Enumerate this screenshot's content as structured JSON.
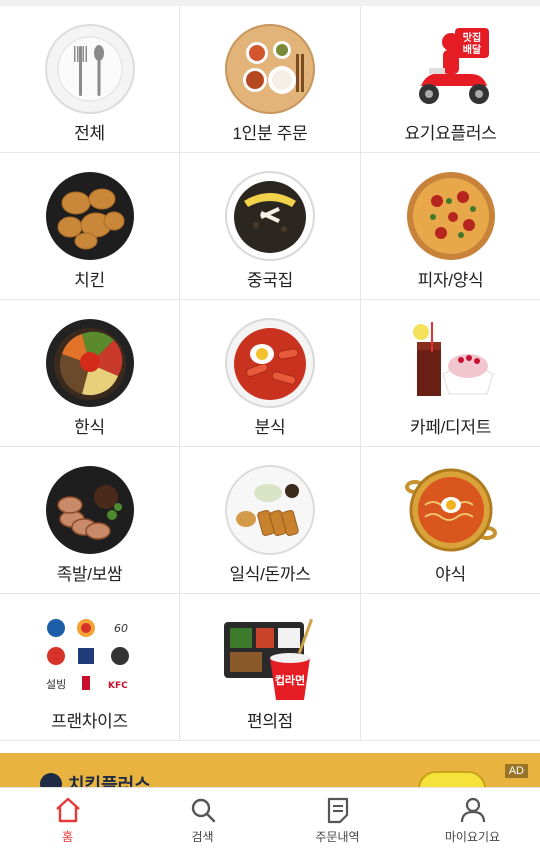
{
  "categories": [
    {
      "label": "전체",
      "icon": "cutlery-plate-icon"
    },
    {
      "label": "1인분 주문",
      "icon": "single-meal-tray-icon"
    },
    {
      "label": "요기요플러스",
      "icon": "delivery-scooter-icon",
      "badge": "맛집\n배달"
    },
    {
      "label": "치킨",
      "icon": "fried-chicken-icon"
    },
    {
      "label": "중국집",
      "icon": "jajangmyeon-icon"
    },
    {
      "label": "피자/양식",
      "icon": "pizza-icon"
    },
    {
      "label": "한식",
      "icon": "bibimbap-icon"
    },
    {
      "label": "분식",
      "icon": "tteokbokki-icon"
    },
    {
      "label": "카페/디저트",
      "icon": "cafe-dessert-icon"
    },
    {
      "label": "족발/보쌈",
      "icon": "jokbal-icon"
    },
    {
      "label": "일식/돈까스",
      "icon": "tonkatsu-icon"
    },
    {
      "label": "야식",
      "icon": "ramen-pot-icon"
    },
    {
      "label": "프랜차이즈",
      "icon": "franchise-logos-icon"
    },
    {
      "label": "편의점",
      "icon": "convenience-store-icon",
      "badge": "컵라면"
    }
  ],
  "banner": {
    "title": "치킨플러스",
    "ad_label": "AD"
  },
  "tabs": [
    {
      "label": "홈",
      "icon": "home-icon",
      "active": true
    },
    {
      "label": "검색",
      "icon": "search-icon"
    },
    {
      "label": "주문내역",
      "icon": "order-history-icon"
    },
    {
      "label": "마이요기요",
      "icon": "profile-icon"
    }
  ],
  "colors": {
    "accent": "#e43a3a",
    "banner_bg": "#e8b33e",
    "divider": "#e6e6e6"
  }
}
